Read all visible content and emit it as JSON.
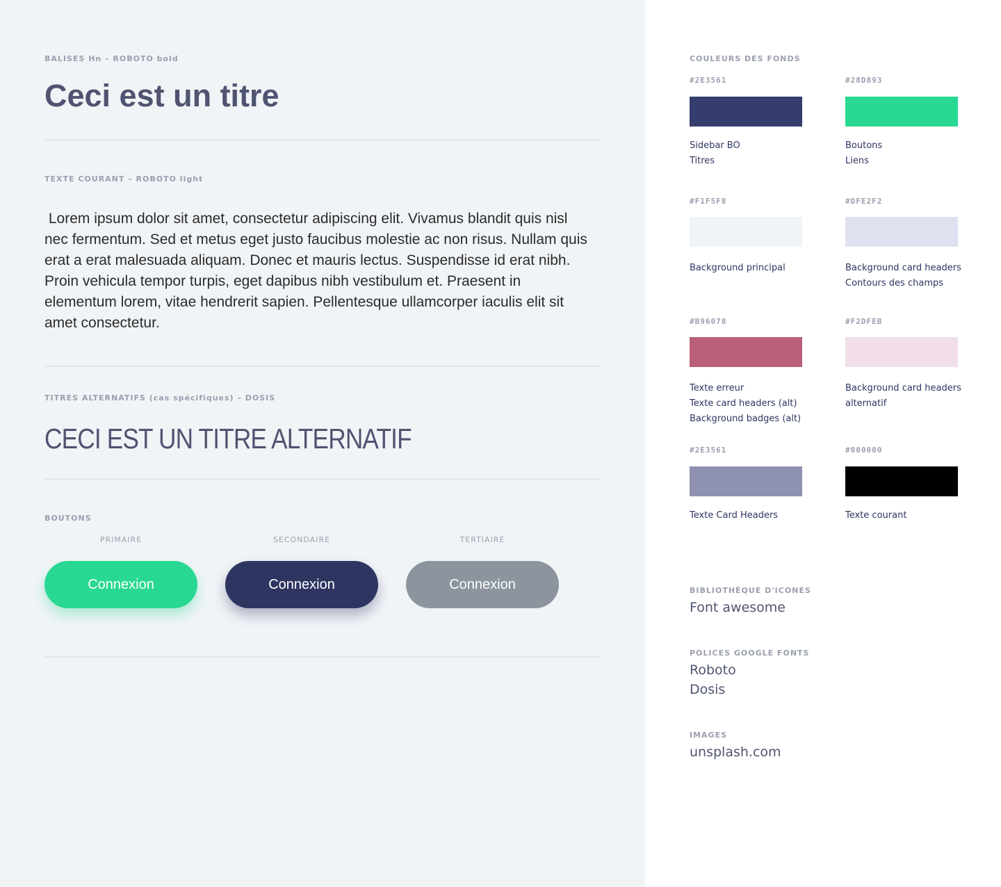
{
  "left": {
    "headings_label": "BALISES Hn – ROBOTO bold",
    "heading_sample": "Ceci est un titre",
    "body_label": "TEXTE COURANT – ROBOTO light",
    "body_sample": " Lorem ipsum dolor sit amet, consectetur adipiscing elit. Vivamus blandit quis nisl nec fermentum. Sed et metus eget justo faucibus molestie ac non risus. Nullam quis erat a erat malesuada aliquam. Donec et mauris lectus. Suspendisse id erat nibh. Proin vehicula tempor turpis, eget dapibus nibh vestibulum et. Praesent in elementum lorem, vitae hendrerit sapien. Pellentesque ullamcorper iaculis elit sit amet consectetur.",
    "alt_label": "TITRES ALTERNATIFS (cas spécifiques) – DOSIS",
    "alt_sample": "CECI EST UN TITRE ALTERNATIF",
    "buttons_label": "BOUTONS",
    "buttons": [
      {
        "caption": "PRIMAIRE",
        "label": "Connexion",
        "color": "#28D893"
      },
      {
        "caption": "SECONDAIRE",
        "label": "Connexion",
        "color": "#2E3561"
      },
      {
        "caption": "TERTIAIRE",
        "label": "Connexion",
        "color": "#8C949D"
      }
    ]
  },
  "right": {
    "colors_label": "COULEURS DES FONDS",
    "swatches": [
      {
        "hex": "#2E3561",
        "color": "#343D6B",
        "desc1": "Sidebar BO",
        "desc2": "Titres",
        "desc3": ""
      },
      {
        "hex": "#28D893",
        "color": "#28D893",
        "desc1": "Boutons",
        "desc2": "Liens",
        "desc3": ""
      },
      {
        "hex": "#F1F5F8",
        "color": "#F1F4F7",
        "desc1": "Background principal",
        "desc2": "",
        "desc3": ""
      },
      {
        "hex": "#DFE2F2",
        "color": "#DFE1F1",
        "desc1": "Background card headers",
        "desc2": "Contours des champs",
        "desc3": ""
      },
      {
        "hex": "#B96078",
        "color": "#B96078",
        "desc1": "Texte erreur",
        "desc2": "Texte card headers (alt)",
        "desc3": "Background badges (alt)"
      },
      {
        "hex": "#F2DFEB",
        "color": "#F2DFEB",
        "desc1": "Background card headers",
        "desc2": "alternatif",
        "desc3": ""
      },
      {
        "hex": "#2E3561",
        "color": "#8E91AF",
        "desc1": "Texte Card Headers",
        "desc2": "",
        "desc3": ""
      },
      {
        "hex": "#000000",
        "color": "#000000",
        "desc1": "Texte courant",
        "desc2": "",
        "desc3": ""
      }
    ],
    "icons_label": "BIBLIOTHÈQUE D'ICONES",
    "icons_value": "Font awesome",
    "fonts_label": "POLICES GOOGLE FONTS",
    "fonts_value1": "Roboto",
    "fonts_value2": "Dosis",
    "images_label": "IMAGES",
    "images_value": "unsplash.com"
  }
}
